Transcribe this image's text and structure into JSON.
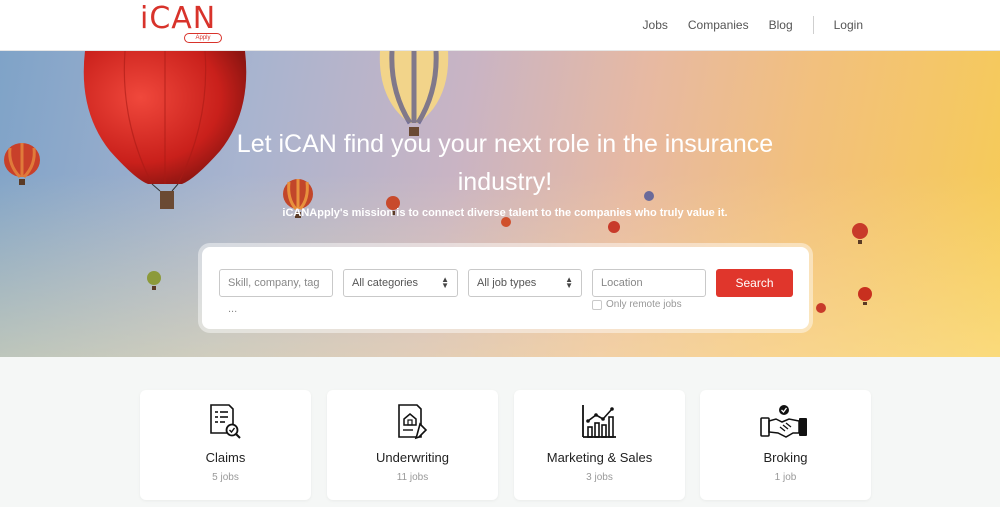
{
  "brand": {
    "name": "iCAN",
    "sub": "Apply",
    "color": "#d8332b"
  },
  "nav": {
    "items": [
      "Jobs",
      "Companies",
      "Blog"
    ],
    "login": "Login"
  },
  "hero": {
    "title": "Let iCAN find you your next role in the insurance industry!",
    "subtitle": "iCANApply's mission is to connect diverse talent to the companies who truly value it."
  },
  "search": {
    "keyword_placeholder": "Skill, company, tag ...",
    "category_value": "All categories",
    "jobtype_value": "All job types",
    "location_placeholder": "Location",
    "button_label": "Search",
    "remote_label": "Only remote jobs",
    "button_color": "#e0362c"
  },
  "categories": [
    {
      "title": "Claims",
      "count": "5 jobs",
      "icon": "claims-document-icon"
    },
    {
      "title": "Underwriting",
      "count": "11 jobs",
      "icon": "underwriting-document-icon"
    },
    {
      "title": "Marketing & Sales",
      "count": "3 jobs",
      "icon": "growth-chart-icon"
    },
    {
      "title": "Broking",
      "count": "1 job",
      "icon": "handshake-icon"
    }
  ]
}
